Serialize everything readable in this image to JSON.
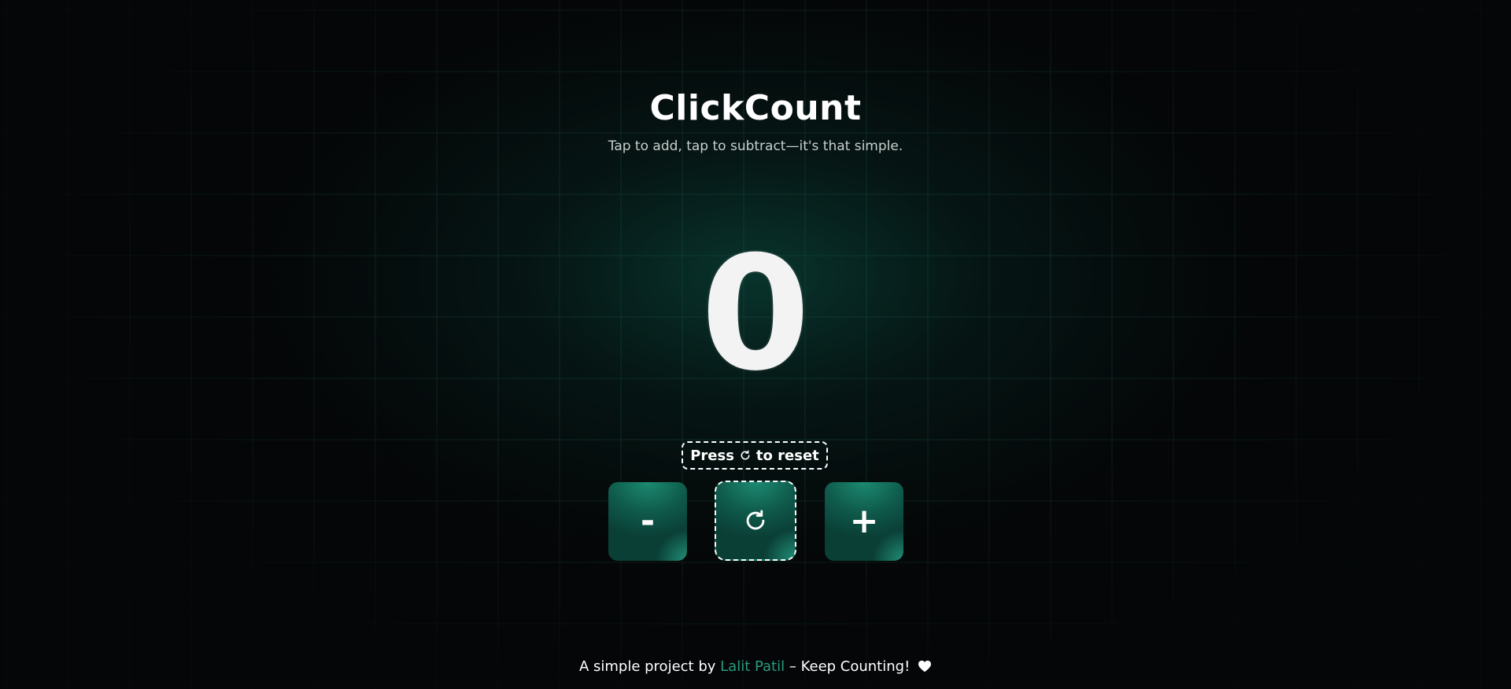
{
  "app": {
    "title": "ClickCount",
    "subtitle": "Tap to add, tap to subtract—it's that simple."
  },
  "counter": {
    "value": "0"
  },
  "hint": {
    "prefix": "Press",
    "icon": "reset-icon",
    "suffix": "to reset"
  },
  "controls": {
    "decrement_label": "-",
    "reset_icon": "reset-icon",
    "increment_label": "+"
  },
  "footer": {
    "prefix": "A simple project by",
    "author": "Lalit Patil",
    "suffix": "– Keep Counting!",
    "icon": "heart-icon"
  },
  "colors": {
    "background": "#050708",
    "accent": "#1b8a70",
    "author_link": "#2a9c80"
  }
}
